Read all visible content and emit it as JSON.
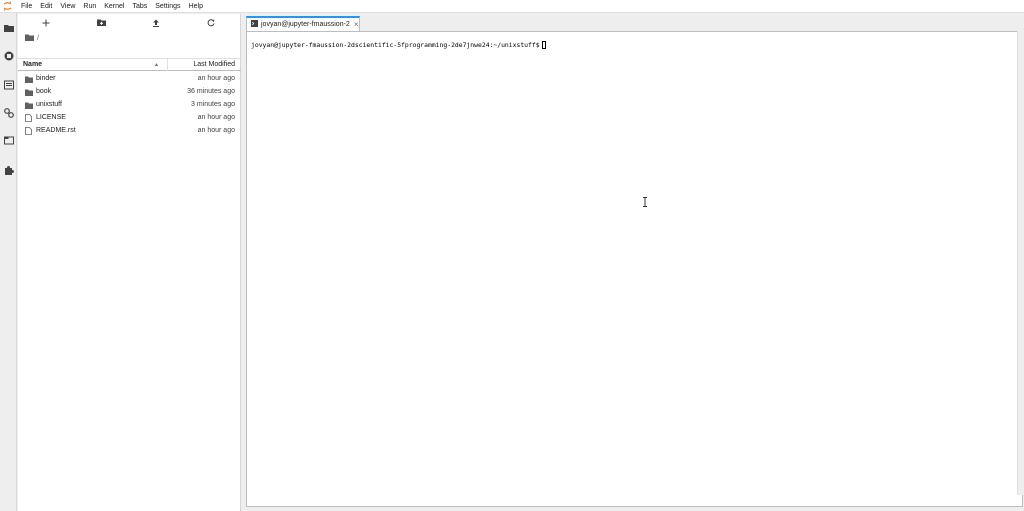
{
  "menubar": {
    "logo_icon": "jupyter-logo-icon",
    "items": [
      "File",
      "Edit",
      "View",
      "Run",
      "Kernel",
      "Tabs",
      "Settings",
      "Help"
    ]
  },
  "activitybar": {
    "icons": [
      "folder-icon",
      "running-icon",
      "commands-icon",
      "property-inspector-icon",
      "tabs-icon",
      "extension-icon"
    ]
  },
  "filebrowser": {
    "toolbar": [
      "new-launcher-icon",
      "new-folder-icon",
      "upload-icon",
      "refresh-icon"
    ],
    "breadcrumb": "/",
    "columns": {
      "name": "Name",
      "modified": "Last Modified"
    },
    "files": [
      {
        "name": "binder",
        "modified": "an hour ago",
        "type": "folder"
      },
      {
        "name": "book",
        "modified": "36 minutes ago",
        "type": "folder"
      },
      {
        "name": "unixstuff",
        "modified": "3 minutes ago",
        "type": "folder"
      },
      {
        "name": "LICENSE",
        "modified": "an hour ago",
        "type": "file"
      },
      {
        "name": "README.rst",
        "modified": "an hour ago",
        "type": "file"
      }
    ]
  },
  "main": {
    "tab": {
      "label": "jovyan@jupyter-fmaussion-2",
      "icon": "terminal-icon"
    },
    "terminal": {
      "prompt": "jovyan@jupyter-fmaussion-2dscientific-5fprogramming-2de7jnwe24:~/unixstuff$"
    }
  },
  "colors": {
    "accent": "#2196f3",
    "folder": "#616161",
    "jupyter_orange": "#f37726"
  }
}
